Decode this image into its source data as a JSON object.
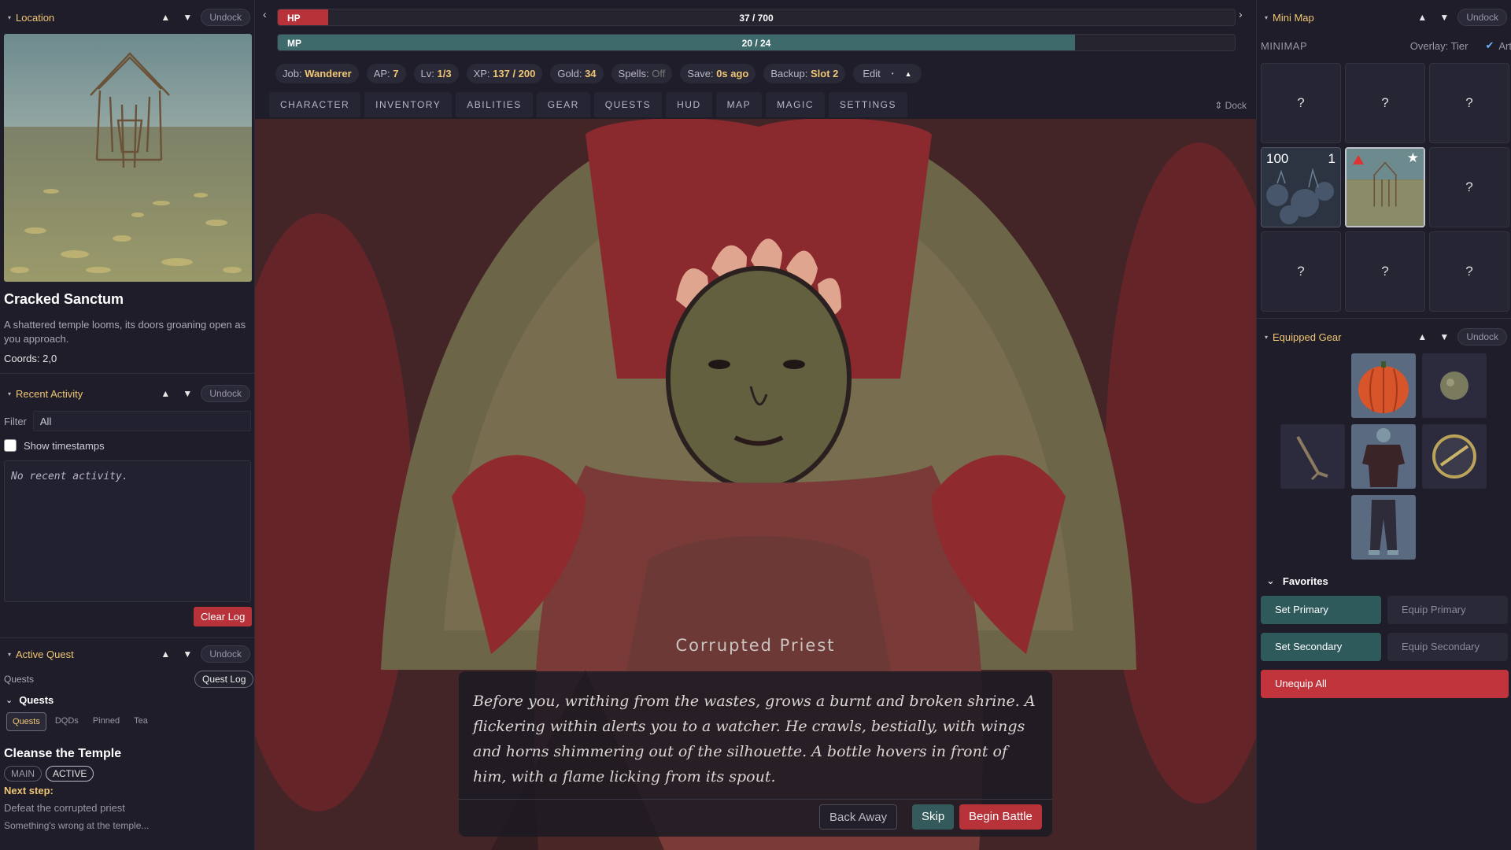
{
  "location_panel": {
    "title": "Location",
    "undock": "Undock",
    "name": "Cracked Sanctum",
    "description": "A shattered temple looms, its doors groaning open as you approach.",
    "coords": "Coords: 2,0"
  },
  "activity_panel": {
    "title": "Recent Activity",
    "undock": "Undock",
    "filter_label": "Filter",
    "filter_value": "All",
    "timestamps_label": "Show timestamps",
    "log_text": "No recent activity.",
    "clear_label": "Clear Log"
  },
  "quest_panel": {
    "title": "Active Quest",
    "undock": "Undock",
    "quests_label": "Quests",
    "quest_log": "Quest Log",
    "sub_title": "Quests",
    "tabs": [
      "Quests",
      "DQDs",
      "Pinned",
      "Tea"
    ],
    "quest_title": "Cleanse the Temple",
    "badges": [
      "MAIN",
      "ACTIVE"
    ],
    "next_step_label": "Next step:",
    "next_step": "Defeat the corrupted priest",
    "description": "Something's wrong at the temple..."
  },
  "status": {
    "hp": {
      "label": "HP",
      "value": "37 / 700",
      "current": 37,
      "max": 700,
      "color": "#b8323a"
    },
    "mp": {
      "label": "MP",
      "value": "20 / 24",
      "current": 20,
      "max": 24,
      "color": "#3e6a6c"
    },
    "stats": [
      {
        "key": "Job:",
        "value": "Wanderer"
      },
      {
        "key": "AP:",
        "value": "7"
      },
      {
        "key": "Lv:",
        "value": "1/3"
      },
      {
        "key": "XP:",
        "value": "137 / 200"
      },
      {
        "key": "Gold:",
        "value": "34"
      },
      {
        "key": "Spells:",
        "value": "Off"
      },
      {
        "key": "Save:",
        "value": "0s ago"
      },
      {
        "key": "Backup:",
        "value": "Slot 2"
      }
    ],
    "edit": "Edit"
  },
  "tabs": [
    "CHARACTER",
    "INVENTORY",
    "ABILITIES",
    "GEAR",
    "QUESTS",
    "HUD",
    "MAP",
    "MAGIC",
    "SETTINGS"
  ],
  "dock_label": "⇕ Dock",
  "encounter": {
    "enemy_name": "Corrupted Priest",
    "text": "Before you, writhing from the wastes, grows a burnt and broken shrine. A flickering within alerts you to a watcher. He crawls, bestially, with wings and horns shimmering out of the silhouette. A bottle hovers in front of him, with a flame licking from its spout.",
    "back_away": "Back Away",
    "skip": "Skip",
    "begin_battle": "Begin Battle"
  },
  "minimap": {
    "title": "Mini Map",
    "undock": "Undock",
    "label": "MINIMAP",
    "overlay": "Overlay: Tier",
    "art": "Art",
    "cells": [
      "?",
      "?",
      "?",
      "",
      "",
      "?",
      "?",
      "?",
      "?"
    ],
    "cell_top_left": "100",
    "cell_top_right": "1"
  },
  "gear": {
    "title": "Equipped Gear",
    "undock": "Undock"
  },
  "favorites": {
    "title": "Favorites",
    "set_primary": "Set Primary",
    "equip_primary": "Equip Primary",
    "set_secondary": "Set Secondary",
    "equip_secondary": "Equip Secondary",
    "unequip_all": "Unequip All"
  }
}
